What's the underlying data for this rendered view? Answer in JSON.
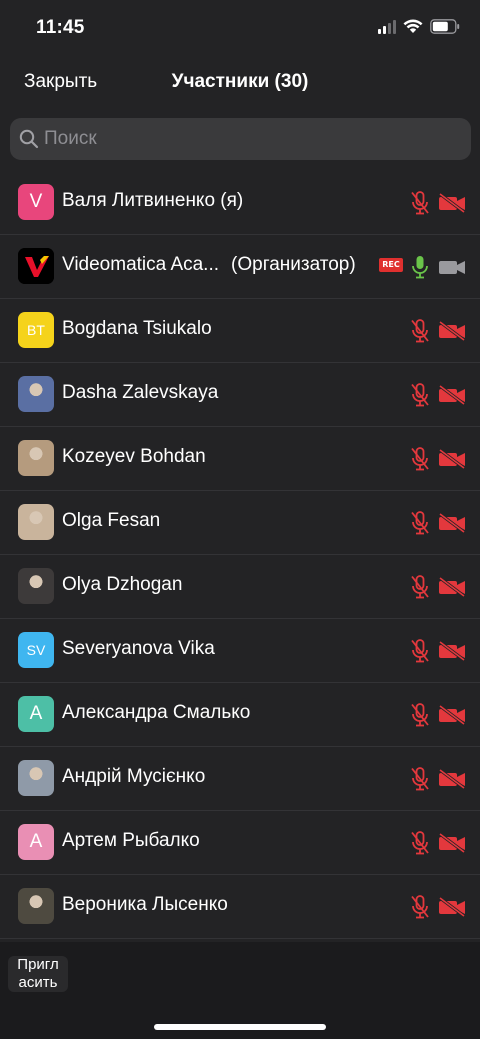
{
  "status_bar": {
    "time": "11:45"
  },
  "header": {
    "close_label": "Закрыть",
    "title": "Участники (30)"
  },
  "search": {
    "placeholder": "Поиск",
    "value": ""
  },
  "participants": [
    {
      "name": "Валя Литвиненко (я)",
      "avatar_text": "V",
      "avatar_color": "#e8467c",
      "mic": "muted",
      "video": "off"
    },
    {
      "name": "Videomatica Aca...",
      "role": "(Организатор)",
      "recording": "REC",
      "avatar_text": "",
      "avatar_color": "#000000",
      "mic": "on",
      "video": "on"
    },
    {
      "name": "Bogdana Tsiukalo",
      "avatar_text": "BT",
      "avatar_color": "#f5d31b",
      "mic": "muted",
      "video": "off"
    },
    {
      "name": "Dasha Zalevskaya",
      "avatar_text": "",
      "avatar_color": "#5a6fa3",
      "mic": "muted",
      "video": "off"
    },
    {
      "name": "Kozeyev Bohdan",
      "avatar_text": "",
      "avatar_color": "#b59b7e",
      "mic": "muted",
      "video": "off"
    },
    {
      "name": "Olga Fesan",
      "avatar_text": "",
      "avatar_color": "#c9b49c",
      "mic": "muted",
      "video": "off"
    },
    {
      "name": "Olya Dzhogan",
      "avatar_text": "",
      "avatar_color": "#3d3a3a",
      "mic": "muted",
      "video": "off"
    },
    {
      "name": "Severyanova Vika",
      "avatar_text": "SV",
      "avatar_color": "#3fb6f0",
      "mic": "muted",
      "video": "off"
    },
    {
      "name": "Александра Смалько",
      "avatar_text": "A",
      "avatar_color": "#4dbfa6",
      "mic": "muted",
      "video": "off"
    },
    {
      "name": "Андрій Мусієнко",
      "avatar_text": "",
      "avatar_color": "#8f9aa8",
      "mic": "muted",
      "video": "off"
    },
    {
      "name": "Артем Рыбалко",
      "avatar_text": "A",
      "avatar_color": "#e98fb4",
      "mic": "muted",
      "video": "off"
    },
    {
      "name": "Вероника Лысенко",
      "avatar_text": "",
      "avatar_color": "#4e4a40",
      "mic": "muted",
      "video": "off"
    }
  ],
  "footer": {
    "invite_label": "Пригл\nасить"
  },
  "colors": {
    "muted_red": "#e3383d",
    "active_green": "#6ac44a",
    "camera_gray": "#9a9a9e"
  },
  "icons": [
    "signal-icon",
    "wifi-icon",
    "battery-icon",
    "search-icon",
    "mic-muted-icon",
    "video-off-icon",
    "mic-icon",
    "video-icon"
  ]
}
